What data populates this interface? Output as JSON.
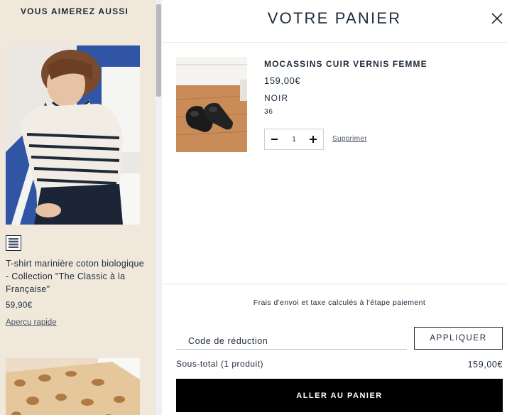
{
  "recommendations": {
    "title": "VOUS AIMEREZ AUSSI",
    "product": {
      "name": "T-shirt marinière coton biologique - Collection \"The Classic à la Française\"",
      "price": "59,90€",
      "quick_view": "Apercu rapide",
      "swatch_icon": "striped-swatch-icon"
    }
  },
  "cart": {
    "title": "VOTRE PANIER",
    "close_icon": "close-icon",
    "item": {
      "name": "MOCASSINS CUIR VERNIS FEMME",
      "price": "159,00€",
      "color": "NOIR",
      "size": "36",
      "quantity": "1",
      "remove_label": "Supprimer"
    },
    "shipping_note": "Frais d'envoi et taxe calculés à l'étape paiement",
    "promo": {
      "placeholder": "Code de réduction",
      "apply_label": "APPLIQUER"
    },
    "subtotal_label": "Sous-total (1 produit)",
    "subtotal_value": "159,00€",
    "checkout_label": "ALLER AU PANIER"
  },
  "colors": {
    "navy": "#1d2a3a",
    "left_bg": "#f1e8dc",
    "checkout_bg": "#000000"
  }
}
